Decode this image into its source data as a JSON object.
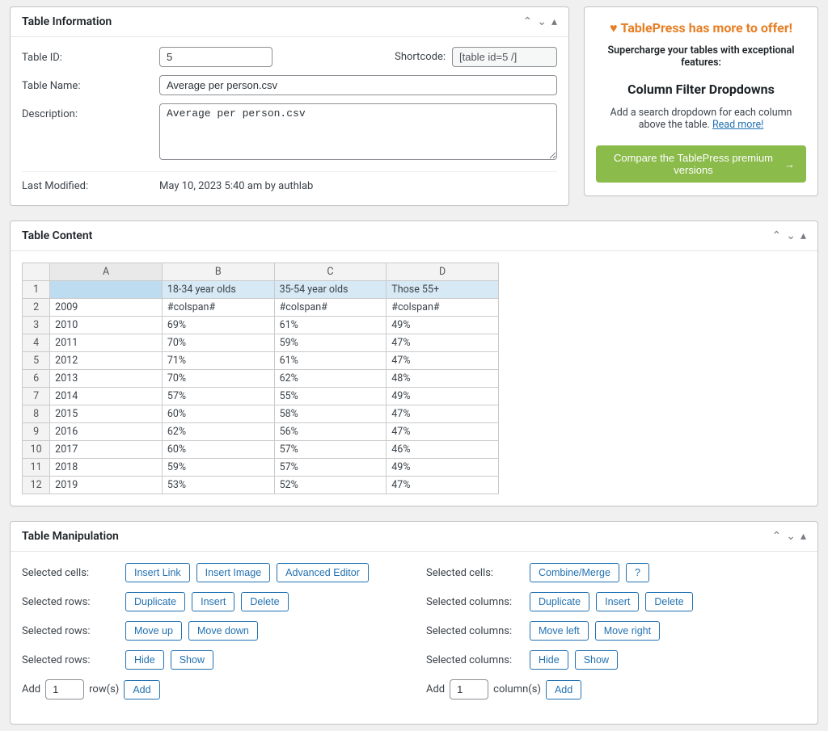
{
  "panels": {
    "info_title": "Table Information",
    "content_title": "Table Content",
    "manip_title": "Table Manipulation"
  },
  "info": {
    "labels": {
      "id": "Table ID:",
      "shortcode": "Shortcode:",
      "name": "Table Name:",
      "description": "Description:",
      "last_modified": "Last Modified:"
    },
    "id_value": "5",
    "shortcode_value": "[table id=5 /]",
    "name_value": "Average per person.csv",
    "description_value": "Average per person.csv",
    "last_modified_value": "May 10, 2023 5:40 am by authlab"
  },
  "promo": {
    "title": "TablePress has more to offer!",
    "subtitle": "Supercharge your tables with exceptional features:",
    "feature": "Column Filter Dropdowns",
    "desc_pre": "Add a search dropdown for each column above the table. ",
    "desc_link": "Read more!",
    "cta": "Compare the TablePress premium versions"
  },
  "sheet": {
    "col_headers": [
      "A",
      "B",
      "C",
      "D"
    ],
    "rows": [
      {
        "n": "1",
        "cells": [
          "",
          "18-34 year olds",
          "35-54 year olds",
          "Those 55+"
        ]
      },
      {
        "n": "2",
        "cells": [
          "2009",
          "#colspan#",
          "#colspan#",
          "#colspan#"
        ]
      },
      {
        "n": "3",
        "cells": [
          "2010",
          "69%",
          "61%",
          "49%"
        ]
      },
      {
        "n": "4",
        "cells": [
          "2011",
          "70%",
          "59%",
          "47%"
        ]
      },
      {
        "n": "5",
        "cells": [
          "2012",
          "71%",
          "61%",
          "47%"
        ]
      },
      {
        "n": "6",
        "cells": [
          "2013",
          "70%",
          "62%",
          "48%"
        ]
      },
      {
        "n": "7",
        "cells": [
          "2014",
          "57%",
          "55%",
          "49%"
        ]
      },
      {
        "n": "8",
        "cells": [
          "2015",
          "60%",
          "58%",
          "47%"
        ]
      },
      {
        "n": "9",
        "cells": [
          "2016",
          "62%",
          "56%",
          "47%"
        ]
      },
      {
        "n": "10",
        "cells": [
          "2017",
          "60%",
          "57%",
          "46%"
        ]
      },
      {
        "n": "11",
        "cells": [
          "2018",
          "59%",
          "57%",
          "49%"
        ]
      },
      {
        "n": "12",
        "cells": [
          "2019",
          "53%",
          "52%",
          "47%"
        ]
      }
    ]
  },
  "manip": {
    "labels": {
      "sel_cells": "Selected cells:",
      "sel_rows": "Selected rows:",
      "sel_cols": "Selected columns:",
      "add": "Add",
      "rows_suffix": "row(s)",
      "cols_suffix": "column(s)"
    },
    "buttons": {
      "insert_link": "Insert Link",
      "insert_image": "Insert Image",
      "advanced_editor": "Advanced Editor",
      "combine_merge": "Combine/Merge",
      "help": "?",
      "duplicate": "Duplicate",
      "insert": "Insert",
      "delete": "Delete",
      "move_up": "Move up",
      "move_down": "Move down",
      "move_left": "Move left",
      "move_right": "Move right",
      "hide": "Hide",
      "show": "Show",
      "add_btn": "Add"
    },
    "add_rows_value": "1",
    "add_cols_value": "1"
  }
}
